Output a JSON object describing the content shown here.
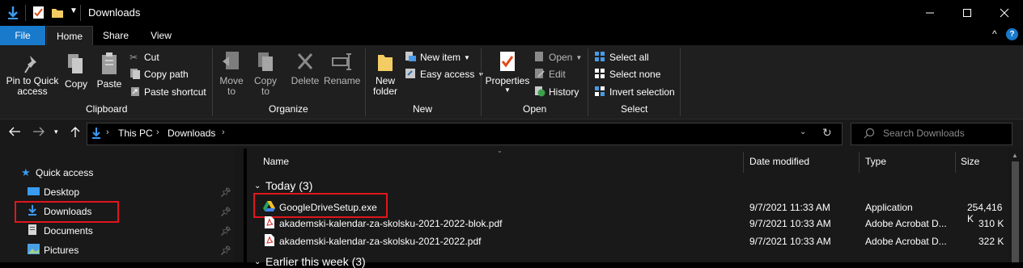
{
  "window": {
    "title": "Downloads"
  },
  "tabs": {
    "file": "File",
    "home": "Home",
    "share": "Share",
    "view": "View"
  },
  "ribbon": {
    "clipboard": {
      "pin": "Pin to Quick\naccess",
      "copy": "Copy",
      "paste": "Paste",
      "cut": "Cut",
      "copy_path": "Copy path",
      "paste_shortcut": "Paste shortcut",
      "group": "Clipboard"
    },
    "organize": {
      "move_to": "Move\nto",
      "copy_to": "Copy\nto",
      "delete": "Delete",
      "rename": "Rename",
      "group": "Organize"
    },
    "new": {
      "new_folder": "New\nfolder",
      "new_item": "New item",
      "easy_access": "Easy access",
      "group": "New"
    },
    "open": {
      "properties": "Properties",
      "open": "Open",
      "edit": "Edit",
      "history": "History",
      "group": "Open"
    },
    "select": {
      "select_all": "Select all",
      "select_none": "Select none",
      "invert": "Invert selection",
      "group": "Select"
    }
  },
  "address": {
    "segments": [
      "This PC",
      "Downloads"
    ],
    "search_placeholder": "Search Downloads"
  },
  "nav": [
    {
      "label": "Quick access",
      "pinned": false
    },
    {
      "label": "Desktop",
      "pinned": true
    },
    {
      "label": "Downloads",
      "pinned": true
    },
    {
      "label": "Documents",
      "pinned": true
    },
    {
      "label": "Pictures",
      "pinned": true
    }
  ],
  "columns": {
    "name": "Name",
    "date": "Date modified",
    "type": "Type",
    "size": "Size"
  },
  "groups": {
    "today": "Today (3)",
    "earlier": "Earlier this week (3)"
  },
  "files": [
    {
      "name": "GoogleDriveSetup.exe",
      "date": "9/7/2021 11:33 AM",
      "type": "Application",
      "size": "254,416 K"
    },
    {
      "name": "akademski-kalendar-za-skolsku-2021-2022-blok.pdf",
      "date": "9/7/2021 10:33 AM",
      "type": "Adobe Acrobat D...",
      "size": "310 K"
    },
    {
      "name": "akademski-kalendar-za-skolsku-2021-2022.pdf",
      "date": "9/7/2021 10:33 AM",
      "type": "Adobe Acrobat D...",
      "size": "322 K"
    }
  ],
  "colors": {
    "accent": "#1979ca",
    "highlight": "#e0161d",
    "background": "#191919"
  }
}
